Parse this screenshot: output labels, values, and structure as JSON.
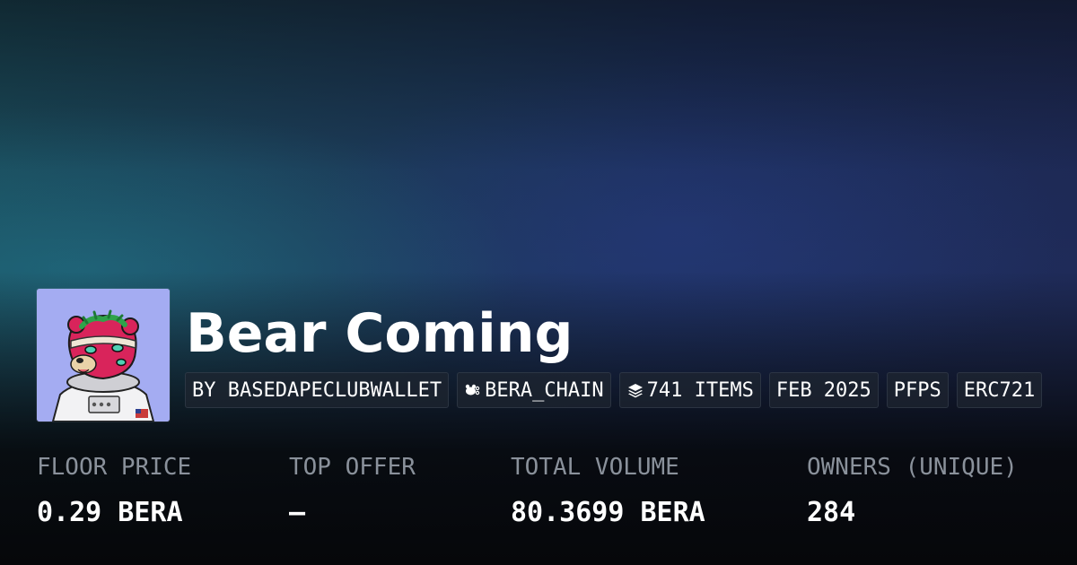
{
  "collection": {
    "title": "Bear Coming",
    "avatar_icon": "bear-astronaut-pfp",
    "chips": [
      {
        "label": "BY BASEDAPECLUBWALLET",
        "icon": null
      },
      {
        "label": "BERA_CHAIN",
        "icon": "bear-chain-icon"
      },
      {
        "label": "741 ITEMS",
        "icon": "layers-icon"
      },
      {
        "label": "FEB 2025",
        "icon": null
      },
      {
        "label": "PFPS",
        "icon": null
      },
      {
        "label": "ERC721",
        "icon": null
      }
    ]
  },
  "stats": [
    {
      "label": "FLOOR PRICE",
      "value": "0.29 BERA"
    },
    {
      "label": "TOP OFFER",
      "value": "—"
    },
    {
      "label": "TOTAL VOLUME",
      "value": "80.3699 BERA"
    },
    {
      "label": "OWNERS (UNIQUE)",
      "value": "284"
    }
  ],
  "colors": {
    "background": "#0c1118",
    "avatar_bg": "#a4acf2",
    "label": "#8a919b",
    "text": "#ffffff"
  }
}
